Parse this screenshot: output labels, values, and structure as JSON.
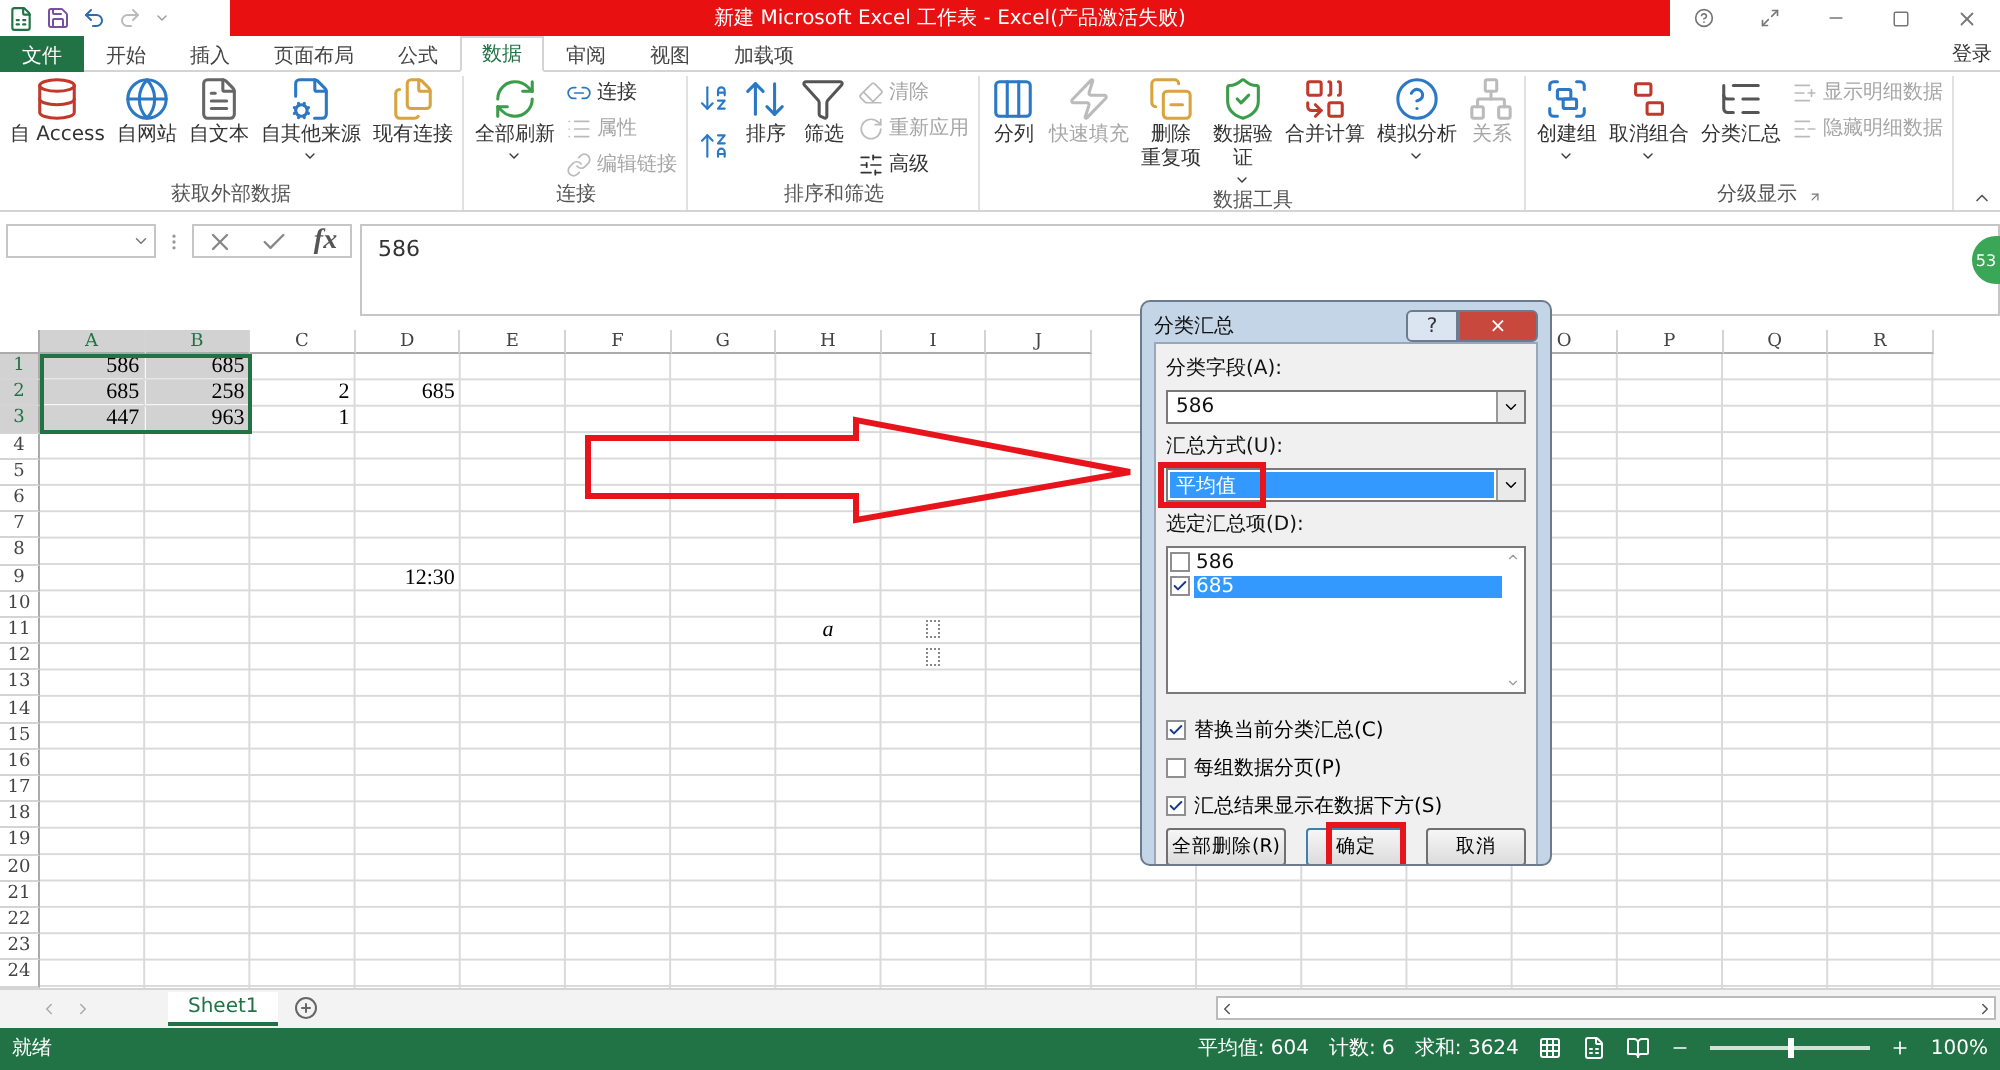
{
  "window": {
    "title": "新建 Microsoft Excel 工作表 - Excel(产品激活失败)",
    "sign_in": "登录"
  },
  "tabs": [
    {
      "label": "文件",
      "kind": "file",
      "selected": false
    },
    {
      "label": "开始",
      "kind": "tab",
      "selected": false
    },
    {
      "label": "插入",
      "kind": "tab",
      "selected": false
    },
    {
      "label": "页面布局",
      "kind": "tab",
      "selected": false
    },
    {
      "label": "公式",
      "kind": "tab",
      "selected": false
    },
    {
      "label": "数据",
      "kind": "tab",
      "selected": true
    },
    {
      "label": "审阅",
      "kind": "tab",
      "selected": false
    },
    {
      "label": "视图",
      "kind": "tab",
      "selected": false
    },
    {
      "label": "加载项",
      "kind": "tab",
      "selected": false
    }
  ],
  "ribbon": {
    "groups": [
      {
        "title": "获取外部数据",
        "launcher": false,
        "items": [
          {
            "kind": "large",
            "lines": [
              "自 Access"
            ],
            "disabled": false,
            "dropdown": false
          },
          {
            "kind": "large",
            "lines": [
              "自网站"
            ],
            "disabled": false,
            "dropdown": false
          },
          {
            "kind": "large",
            "lines": [
              "自文本"
            ],
            "disabled": false,
            "dropdown": false
          },
          {
            "kind": "large",
            "lines": [
              "自其他来源"
            ],
            "disabled": false,
            "dropdown": true
          },
          {
            "kind": "large",
            "lines": [
              "现有连接"
            ],
            "disabled": false,
            "dropdown": false
          }
        ]
      },
      {
        "title": "连接",
        "launcher": false,
        "items": [
          {
            "kind": "large",
            "lines": [
              "全部刷新"
            ],
            "disabled": false,
            "dropdown": true
          },
          {
            "kind": "small",
            "lines": [
              "连接"
            ],
            "disabled": false,
            "dropdown": false
          },
          {
            "kind": "small",
            "lines": [
              "属性"
            ],
            "disabled": true,
            "dropdown": false
          },
          {
            "kind": "small",
            "lines": [
              "编辑链接"
            ],
            "disabled": true,
            "dropdown": false
          }
        ]
      },
      {
        "title": "排序和筛选",
        "launcher": false,
        "items": [
          {
            "kind": "icon",
            "disabled": false,
            "dropdown": false
          },
          {
            "kind": "icon",
            "disabled": false,
            "dropdown": false
          },
          {
            "kind": "large",
            "lines": [
              "排序"
            ],
            "disabled": false,
            "dropdown": false
          },
          {
            "kind": "large",
            "lines": [
              "筛选"
            ],
            "disabled": false,
            "dropdown": false
          },
          {
            "kind": "small",
            "lines": [
              "清除"
            ],
            "disabled": true,
            "dropdown": false
          },
          {
            "kind": "small",
            "lines": [
              "重新应用"
            ],
            "disabled": true,
            "dropdown": false
          },
          {
            "kind": "small",
            "lines": [
              "高级"
            ],
            "disabled": false,
            "dropdown": false
          }
        ]
      },
      {
        "title": "数据工具",
        "launcher": false,
        "items": [
          {
            "kind": "large",
            "lines": [
              "分列"
            ],
            "disabled": false,
            "dropdown": false
          },
          {
            "kind": "large",
            "lines": [
              "快速填充"
            ],
            "disabled": true,
            "dropdown": false
          },
          {
            "kind": "large",
            "lines": [
              "删除",
              "重复项"
            ],
            "disabled": false,
            "dropdown": false
          },
          {
            "kind": "large",
            "lines": [
              "数据验",
              "证"
            ],
            "disabled": false,
            "dropdown": true
          },
          {
            "kind": "large",
            "lines": [
              "合并计算"
            ],
            "disabled": false,
            "dropdown": false
          },
          {
            "kind": "large",
            "lines": [
              "模拟分析"
            ],
            "disabled": false,
            "dropdown": true
          },
          {
            "kind": "large",
            "lines": [
              "关系"
            ],
            "disabled": true,
            "dropdown": false
          }
        ]
      },
      {
        "title": "分级显示",
        "launcher": true,
        "items": [
          {
            "kind": "large",
            "lines": [
              "创建组"
            ],
            "disabled": false,
            "dropdown": true
          },
          {
            "kind": "large",
            "lines": [
              "取消组合"
            ],
            "disabled": false,
            "dropdown": true
          },
          {
            "kind": "large",
            "lines": [
              "分类汇总"
            ],
            "disabled": false,
            "dropdown": false
          },
          {
            "kind": "small",
            "lines": [
              "显示明细数据"
            ],
            "disabled": true,
            "dropdown": false
          },
          {
            "kind": "small",
            "lines": [
              "隐藏明细数据"
            ],
            "disabled": true,
            "dropdown": false
          }
        ]
      }
    ]
  },
  "formula_bar": {
    "function_button": "fx",
    "value": "586"
  },
  "side_badge": "53",
  "column_headers_left": [
    {
      "label": "A",
      "selected": true
    },
    {
      "label": "B",
      "selected": true
    },
    {
      "label": "C",
      "selected": false
    },
    {
      "label": "D",
      "selected": false
    },
    {
      "label": "E",
      "selected": false
    },
    {
      "label": "F",
      "selected": false
    },
    {
      "label": "G",
      "selected": false
    },
    {
      "label": "H",
      "selected": false
    },
    {
      "label": "I",
      "selected": false
    },
    {
      "label": "J",
      "selected": false
    }
  ],
  "column_headers_right": [
    {
      "label": "O",
      "selected": false
    },
    {
      "label": "P",
      "selected": false
    },
    {
      "label": "Q",
      "selected": false
    },
    {
      "label": "R",
      "selected": false
    }
  ],
  "rows": [
    {
      "label": "1",
      "selected": true,
      "marker": false,
      "col_a": "586",
      "col_b": "685"
    },
    {
      "label": "2",
      "selected": true,
      "marker": false,
      "col_a": "685",
      "col_b": "258",
      "col_c": "2",
      "col_d": "685"
    },
    {
      "label": "3",
      "selected": true,
      "marker": false,
      "col_a": "447",
      "col_b": "963",
      "col_c": "1"
    },
    {
      "label": "4",
      "selected": false,
      "marker": false
    },
    {
      "label": "5",
      "selected": false,
      "marker": false
    },
    {
      "label": "6",
      "selected": false,
      "marker": false
    },
    {
      "label": "7",
      "selected": false,
      "marker": false
    },
    {
      "label": "8",
      "selected": false,
      "marker": false
    },
    {
      "label": "9",
      "selected": false,
      "marker": false,
      "col_d": "12:30"
    },
    {
      "label": "10",
      "selected": false,
      "marker": false
    },
    {
      "label": "11",
      "selected": false,
      "marker": true,
      "col_h": "a"
    },
    {
      "label": "12",
      "selected": false,
      "marker": true
    },
    {
      "label": "13",
      "selected": false,
      "marker": false
    },
    {
      "label": "14",
      "selected": false,
      "marker": false
    },
    {
      "label": "15",
      "selected": false,
      "marker": false
    },
    {
      "label": "16",
      "selected": false,
      "marker": false
    },
    {
      "label": "17",
      "selected": false,
      "marker": false
    },
    {
      "label": "18",
      "selected": false,
      "marker": false
    },
    {
      "label": "19",
      "selected": false,
      "marker": false
    },
    {
      "label": "20",
      "selected": false,
      "marker": false
    },
    {
      "label": "21",
      "selected": false,
      "marker": false
    },
    {
      "label": "22",
      "selected": false,
      "marker": false
    },
    {
      "label": "23",
      "selected": false,
      "marker": false
    },
    {
      "label": "24",
      "selected": false,
      "marker": false
    }
  ],
  "dialog": {
    "title": "分类汇总",
    "help": "?",
    "close": "×",
    "group_by": {
      "label": "分类字段(A):",
      "value": "586"
    },
    "function": {
      "label": "汇总方式(U):",
      "value": "平均值",
      "focused": true
    },
    "items_label": "选定汇总项(D):",
    "items": [
      {
        "label": "586",
        "checked": false,
        "selected": false
      },
      {
        "label": "685",
        "checked": true,
        "selected": true
      }
    ],
    "options": [
      {
        "label": "替换当前分类汇总(C)",
        "checked": true
      },
      {
        "label": "每组数据分页(P)",
        "checked": false
      },
      {
        "label": "汇总结果显示在数据下方(S)",
        "checked": true
      }
    ],
    "buttons": [
      {
        "label": "全部删除(R)",
        "default": false
      },
      {
        "label": "确定",
        "default": true
      },
      {
        "label": "取消",
        "default": false
      }
    ]
  },
  "sheets": [
    {
      "label": "Sheet1",
      "selected": true
    }
  ],
  "status_bar": {
    "status": "就绪",
    "average": "平均值: 604",
    "count": "计数: 6",
    "sum": "求和: 3624",
    "zoom": "100%",
    "zoom_level": {
      "level": 0.5
    }
  }
}
